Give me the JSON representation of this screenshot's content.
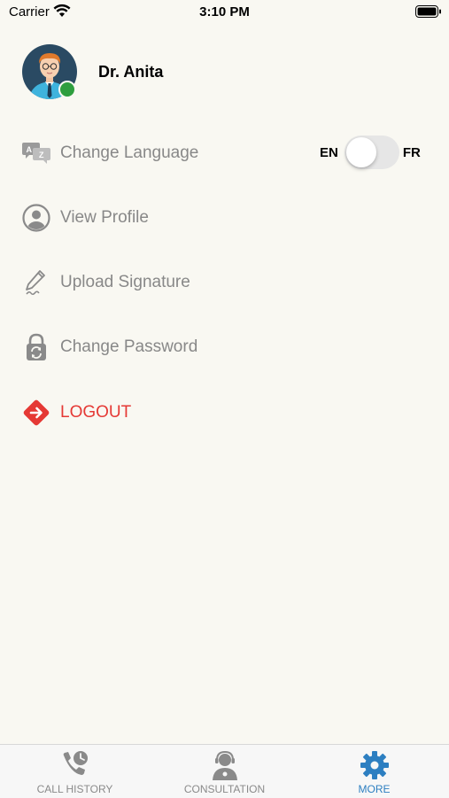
{
  "status_bar": {
    "carrier": "Carrier",
    "time": "3:10 PM"
  },
  "profile": {
    "name": "Dr. Anita",
    "status_color": "#2e9e3e"
  },
  "language": {
    "left_code": "EN",
    "right_code": "FR",
    "selected": "EN"
  },
  "menu": {
    "items": [
      {
        "label": "Change Language",
        "icon": "translate-icon"
      },
      {
        "label": "View Profile",
        "icon": "user-circle-icon"
      },
      {
        "label": "Upload Signature",
        "icon": "pen-signature-icon"
      },
      {
        "label": "Change Password",
        "icon": "lock-refresh-icon"
      },
      {
        "label": "LOGOUT",
        "icon": "logout-icon"
      }
    ]
  },
  "tab_bar": {
    "tabs": [
      {
        "label": "CALL HISTORY",
        "icon": "call-history-icon"
      },
      {
        "label": "CONSULTATION",
        "icon": "consultation-icon"
      },
      {
        "label": "MORE",
        "icon": "gear-icon"
      }
    ],
    "active": "MORE"
  },
  "colors": {
    "background": "#f9f8f2",
    "accent": "#2d7fc1",
    "logout": "#e53935",
    "muted_text": "#888888"
  }
}
